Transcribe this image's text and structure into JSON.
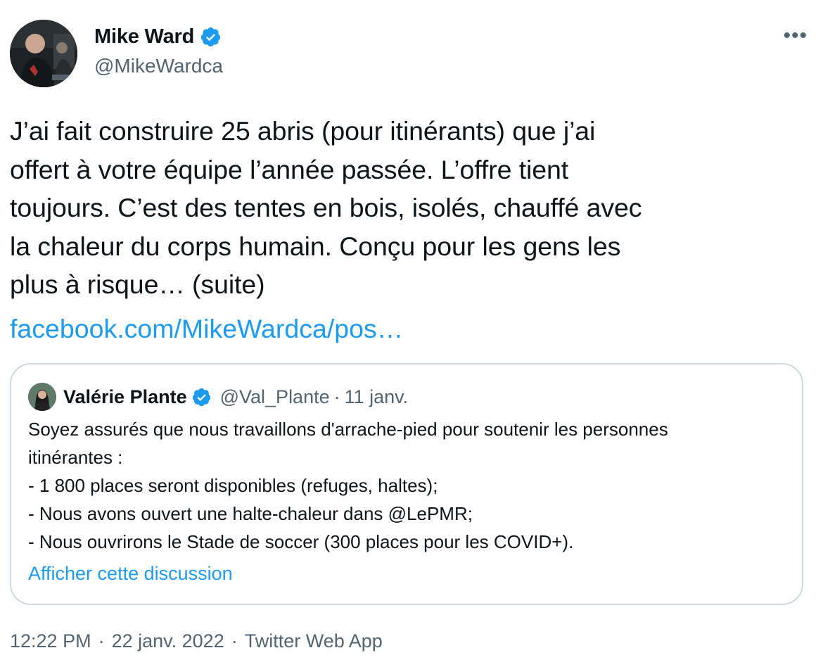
{
  "author": {
    "display_name": "Mike Ward",
    "handle": "@MikeWardca",
    "verified": true
  },
  "more_icon": "more-horizontal-icon",
  "tweet": {
    "text": "J’ai fait construire 25 abris (pour itinérants) que j’ai\noffert à votre équipe l’année passée. L’offre tient\ntoujours. C’est des tentes en bois, isolés, chauffé avec\nla chaleur du corps humain. Conçu pour les gens les\nplus à risque… (suite)",
    "link": "facebook.com/MikeWardca/pos…"
  },
  "quote": {
    "display_name": "Valérie Plante",
    "handle": "@Val_Plante",
    "separator": "·",
    "date": "11 janv.",
    "lines": [
      "Soyez assurés que nous travaillons d'arrache-pied pour soutenir les personnes",
      "itinérantes :",
      "- 1 800 places seront disponibles (refuges, haltes);",
      "- Nous avons ouvert une halte-chaleur dans @LePMR;",
      "- Nous ouvrirons le Stade de soccer (300 places pour les COVID+)."
    ],
    "show_thread": "Afficher cette discussion"
  },
  "meta": {
    "time": "12:22 PM",
    "sep1": "·",
    "date": "22 janv. 2022",
    "sep2": "·",
    "source": "Twitter Web App"
  },
  "colors": {
    "link": "#1d9bf0",
    "verified": "#1d9bf0",
    "secondary_text": "#536471",
    "border": "#cfd9de"
  }
}
